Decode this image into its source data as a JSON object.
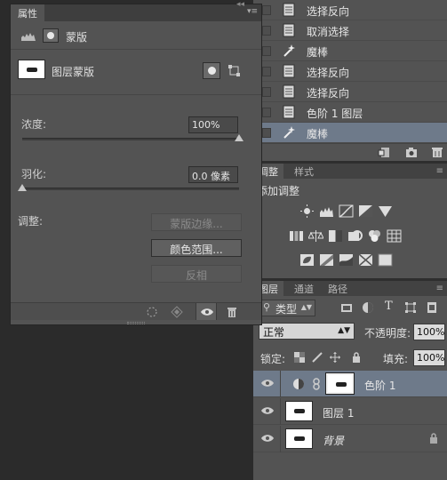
{
  "history": {
    "items": [
      {
        "label": "选择反向",
        "icon": "document-icon",
        "selected": false
      },
      {
        "label": "取消选择",
        "icon": "document-icon",
        "selected": false
      },
      {
        "label": "魔棒",
        "icon": "magic-wand-icon",
        "selected": false
      },
      {
        "label": "选择反向",
        "icon": "document-icon",
        "selected": false
      },
      {
        "label": "选择反向",
        "icon": "document-icon",
        "selected": false
      },
      {
        "label": "色阶 1 图层",
        "icon": "document-icon",
        "selected": false
      },
      {
        "label": "魔棒",
        "icon": "magic-wand-icon",
        "selected": true
      }
    ]
  },
  "adjustments": {
    "tabs": [
      "调整",
      "样式"
    ],
    "title": "添加调整"
  },
  "layers": {
    "tabs": [
      "图层",
      "通道",
      "路径"
    ],
    "filter_label": "类型",
    "blend_mode": "正常",
    "opacity_label": "不透明度:",
    "opacity_value": "100%",
    "lock_label": "锁定:",
    "fill_label": "填充:",
    "fill_value": "100%",
    "rows": [
      {
        "name": "色阶 1",
        "selected": true,
        "italic": false
      },
      {
        "name": "图层 1",
        "selected": false,
        "italic": false
      },
      {
        "name": "背景",
        "selected": false,
        "italic": true
      }
    ]
  },
  "properties": {
    "tab_label": "属性",
    "header_label": "蒙版",
    "mask_label": "图层蒙版",
    "density_label": "浓度:",
    "density_value": "100%",
    "density_fraction": 1.0,
    "feather_label": "羽化:",
    "feather_value": "0.0 像素",
    "feather_fraction": 0.0,
    "refine_label": "调整:",
    "btn_mask_edge": "蒙版边缘...",
    "btn_color_range": "颜色范围...",
    "btn_invert": "反相"
  },
  "colors": {
    "panel_bg": "#535353",
    "selection": "#6e7a8a",
    "canvas": "#2b2b2b"
  }
}
